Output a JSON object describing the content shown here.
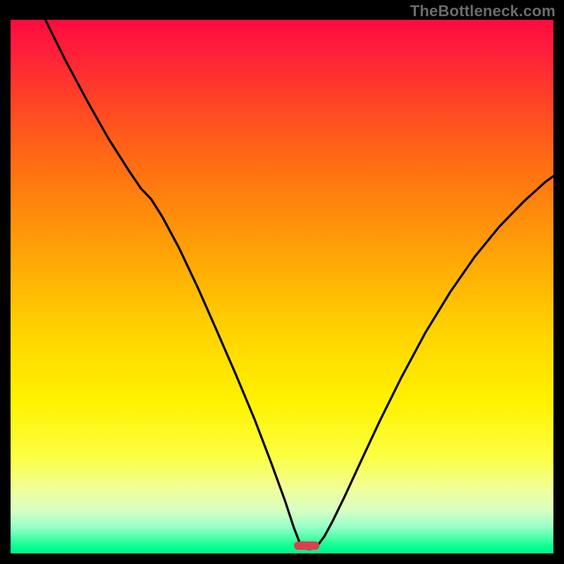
{
  "watermark": "TheBottleneck.com",
  "colors": {
    "frame": "#000000",
    "marker": "#d9414e",
    "curve": "#000000",
    "gradient_top": "#ff0b3e",
    "gradient_bottom": "#00f38a"
  },
  "marker": {
    "x_frac": 0.545,
    "y_frac": 0.986
  },
  "chart_data": {
    "type": "line",
    "title": "",
    "xlabel": "",
    "ylabel": "",
    "xlim": [
      0,
      1
    ],
    "ylim": [
      0,
      1
    ],
    "note": "Axes unlabeled in source; x/y are normalized fractions of the plot area (0,0 = top-left). Values estimated from pixels.",
    "series": [
      {
        "name": "bottleneck-curve",
        "points": [
          {
            "x": 0.064,
            "y": 0.0
          },
          {
            "x": 0.1,
            "y": 0.074
          },
          {
            "x": 0.14,
            "y": 0.15
          },
          {
            "x": 0.18,
            "y": 0.222
          },
          {
            "x": 0.218,
            "y": 0.283
          },
          {
            "x": 0.24,
            "y": 0.316
          },
          {
            "x": 0.259,
            "y": 0.336
          },
          {
            "x": 0.28,
            "y": 0.37
          },
          {
            "x": 0.31,
            "y": 0.427
          },
          {
            "x": 0.345,
            "y": 0.502
          },
          {
            "x": 0.38,
            "y": 0.583
          },
          {
            "x": 0.415,
            "y": 0.665
          },
          {
            "x": 0.45,
            "y": 0.75
          },
          {
            "x": 0.48,
            "y": 0.83
          },
          {
            "x": 0.505,
            "y": 0.9
          },
          {
            "x": 0.522,
            "y": 0.952
          },
          {
            "x": 0.533,
            "y": 0.981
          },
          {
            "x": 0.54,
            "y": 0.991
          },
          {
            "x": 0.552,
            "y": 0.992
          },
          {
            "x": 0.565,
            "y": 0.986
          },
          {
            "x": 0.578,
            "y": 0.968
          },
          {
            "x": 0.593,
            "y": 0.94
          },
          {
            "x": 0.615,
            "y": 0.894
          },
          {
            "x": 0.645,
            "y": 0.828
          },
          {
            "x": 0.68,
            "y": 0.752
          },
          {
            "x": 0.72,
            "y": 0.67
          },
          {
            "x": 0.765,
            "y": 0.585
          },
          {
            "x": 0.81,
            "y": 0.51
          },
          {
            "x": 0.855,
            "y": 0.444
          },
          {
            "x": 0.9,
            "y": 0.388
          },
          {
            "x": 0.945,
            "y": 0.341
          },
          {
            "x": 0.985,
            "y": 0.304
          },
          {
            "x": 1.0,
            "y": 0.293
          }
        ]
      }
    ]
  }
}
